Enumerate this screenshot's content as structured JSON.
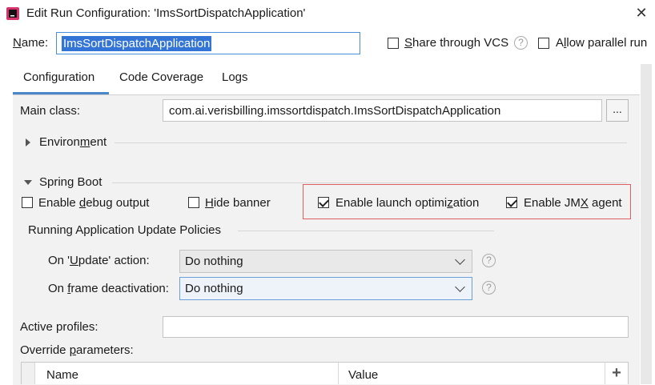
{
  "window": {
    "title": "Edit Run Configuration: 'ImsSortDispatchApplication'",
    "icon": "intellij-app-icon",
    "close_glyph": "✕"
  },
  "name_row": {
    "label": "Name:",
    "value": "ImsSortDispatchApplication",
    "share_vcs": {
      "label": "Share through VCS",
      "checked": false
    },
    "allow_parallel": {
      "label": "Allow parallel run",
      "checked": false
    },
    "help_glyph": "?"
  },
  "tabs": [
    {
      "label": "Configuration",
      "active": true
    },
    {
      "label": "Code Coverage",
      "active": false
    },
    {
      "label": "Logs",
      "active": false
    }
  ],
  "main_class": {
    "label": "Main class:",
    "value": "com.ai.verisbilling.imssortdispatch.ImsSortDispatchApplication",
    "browse_label": "..."
  },
  "environment": {
    "label": "Environment",
    "expanded": false
  },
  "spring_boot": {
    "label": "Spring Boot",
    "expanded": true,
    "enable_debug": {
      "label": "Enable debug output",
      "checked": false
    },
    "hide_banner": {
      "label": "Hide banner",
      "checked": false
    },
    "launch_optimization": {
      "label": "Enable launch optimization",
      "checked": true
    },
    "jmx_agent": {
      "label": "Enable JMX agent",
      "checked": true
    },
    "highlight_color": "#e06060"
  },
  "update_policies": {
    "label": "Running Application Update Policies",
    "on_update": {
      "label": "On 'Update' action:",
      "value": "Do nothing"
    },
    "on_frame": {
      "label": "On frame deactivation:",
      "value": "Do nothing"
    }
  },
  "active_profiles": {
    "label": "Active profiles:",
    "value": ""
  },
  "override": {
    "label": "Override parameters:",
    "columns": [
      "Name",
      "Value"
    ],
    "add_glyph": "+"
  },
  "colors": {
    "accent": "#4a88c7",
    "selection": "#3375d6"
  }
}
